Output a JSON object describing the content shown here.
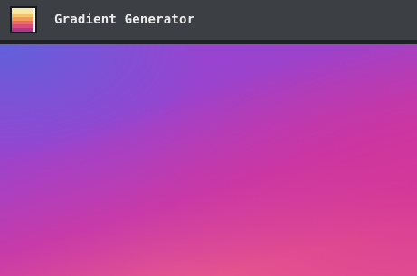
{
  "window": {
    "title": "Gradient Generator",
    "icon": "gradient-app-icon"
  },
  "gradient": {
    "colors": {
      "top_left": "#5a64dc",
      "upper_left": "#9844d0",
      "center": "#c83aa8",
      "bottom_left": "#e8588c",
      "right": "#d0309a"
    }
  }
}
